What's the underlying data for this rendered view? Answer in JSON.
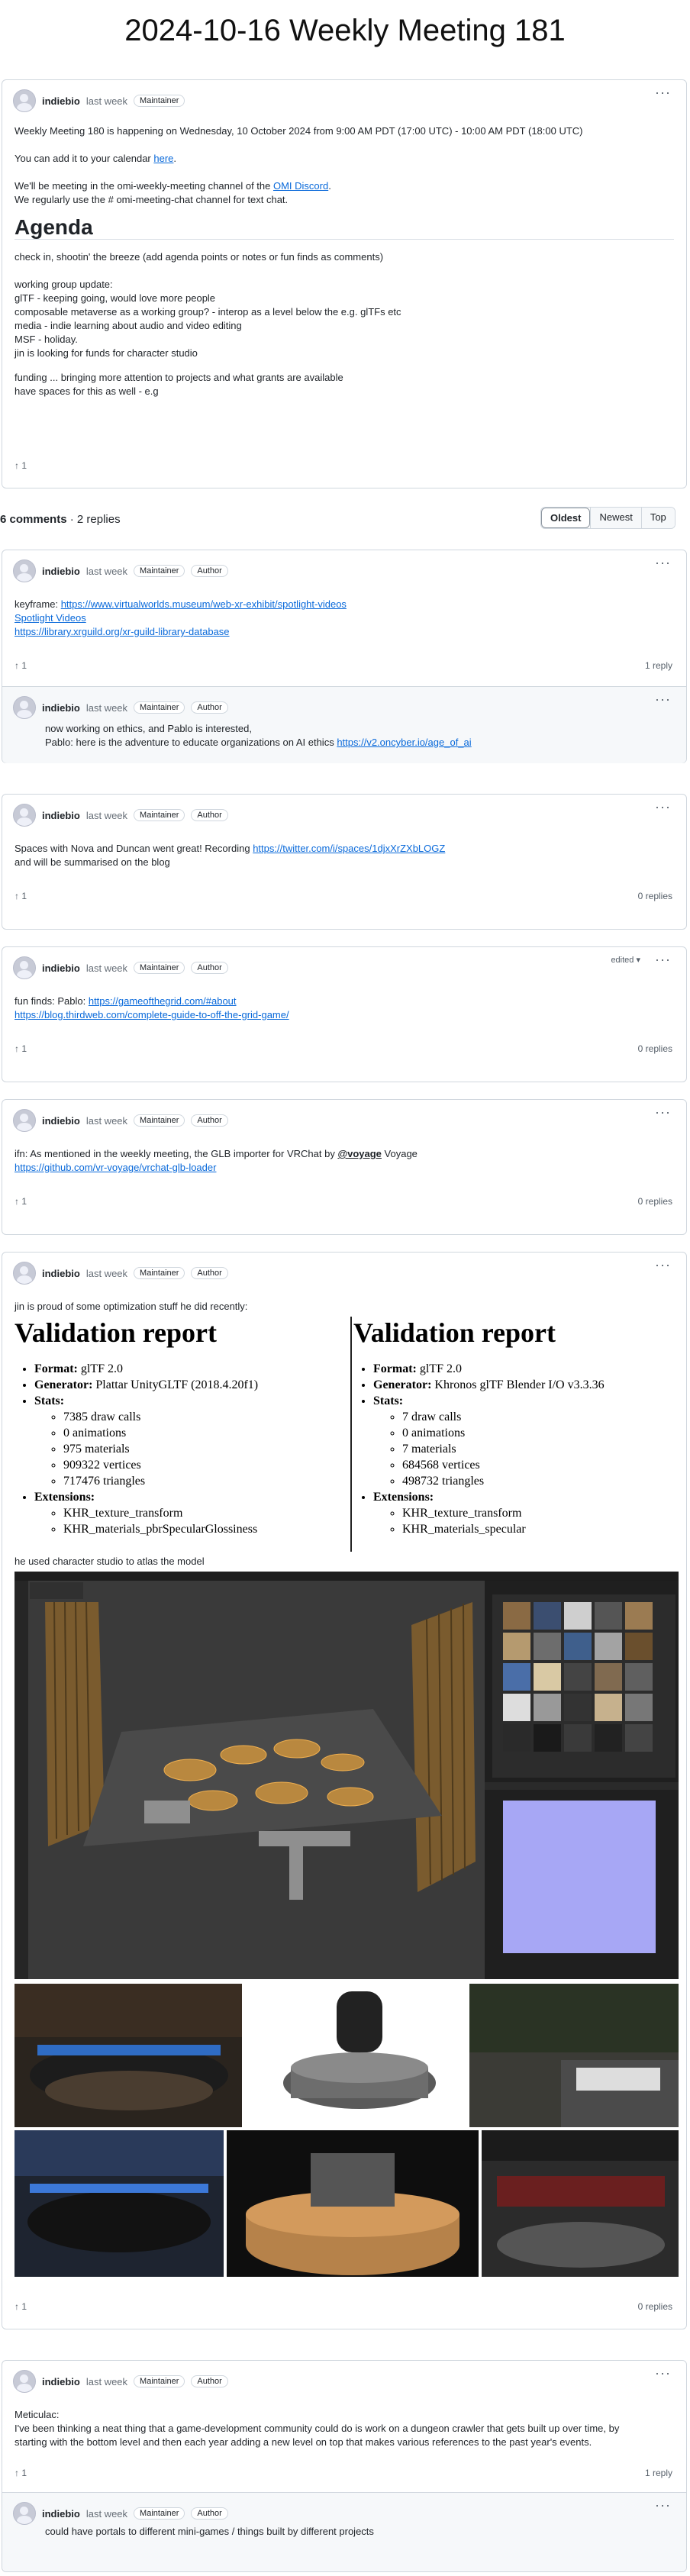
{
  "page_title": "2024-10-16 Weekly Meeting 181",
  "author": "indiebio",
  "time_ago": "last week",
  "badges": {
    "maintainer": "Maintainer",
    "author": "Author"
  },
  "more_label": "···",
  "edited_label": "edited ▾",
  "post": {
    "line1": "Weekly Meeting 180 is happening on Wednesday, 10 October 2024 from 9:00 AM PDT (17:00 UTC) - 10:00 AM PDT (18:00 UTC)",
    "calendar_prefix": "You can add it to your calendar ",
    "calendar_link": "here",
    "discord_prefix": "We'll be meeting in the omi-weekly-meeting channel of the ",
    "discord_link": "OMI Discord",
    "discord_line2": "We regularly use the # omi-meeting-chat channel for text chat.",
    "agenda_heading": "Agenda",
    "agenda_intro": "check in, shootin' the breeze (add agenda points or notes or fun finds as comments)",
    "wg_lines": [
      "working group update:",
      "glTF - keeping going, would love more people",
      "composable metaverse as a working group? - interop as a level below the e.g. glTFs etc",
      "media - indie learning about audio and video editing",
      "MSF - holiday.",
      "jin is looking for funds for character studio"
    ],
    "funding_lines": [
      "funding ... bringing more attention to projects and what grants are available",
      "have spaces for this as well - e.g"
    ],
    "reactions": "↑ 1"
  },
  "comments_header": {
    "count": "6 comments",
    "dot": " · ",
    "replies": "2 replies"
  },
  "sort": [
    "Oldest",
    "Newest",
    "Top"
  ],
  "comments": {
    "c1": {
      "prefix": "keyframe: ",
      "link1": "https://www.virtualworlds.museum/web-xr-exhibit/spotlight-videos",
      "link2": "Spotlight Videos",
      "link3": "https://library.xrguild.org/xr-guild-library-database",
      "reactions": "↑ 1",
      "replies": "1 reply"
    },
    "c1r": {
      "line1": "now working on ethics, and Pablo is interested,",
      "line2_prefix": "Pablo: here is the adventure to educate organizations on AI ethics ",
      "line2_link": "https://v2.oncyber.io/age_of_ai"
    },
    "c2": {
      "prefix": "Spaces with Nova and Duncan went great! Recording ",
      "link": "https://twitter.com/i/spaces/1djxXrZXbLOGZ",
      "line2": "and will be summarised on the blog",
      "reactions": "↑ 1",
      "replies": "0 replies"
    },
    "c3": {
      "prefix": "fun finds: Pablo: ",
      "link1": "https://gameofthegrid.com/#about",
      "link2": "https://blog.thirdweb.com/complete-guide-to-off-the-grid-game/",
      "reactions": "↑ 1",
      "replies": "0 replies"
    },
    "c4": {
      "prefix": "ifn: As mentioned in the weekly meeting, the GLB importer for VRChat by ",
      "mention": "@voyage",
      "suffix": " Voyage",
      "link": "https://github.com/vr-voyage/vrchat-glb-loader",
      "reactions": "↑ 1",
      "replies": "0 replies"
    },
    "c5": {
      "intro": "jin is proud of some optimization stuff he did recently:",
      "left": {
        "heading": "Validation report",
        "format_label": "Format:",
        "format": " glTF 2.0",
        "gen_label": "Generator:",
        "generator": " Plattar UnityGLTF (2018.4.20f1)",
        "stats_label": "Stats:",
        "stats": [
          "7385 draw calls",
          "0 animations",
          "975 materials",
          "909322 vertices",
          "717476 triangles"
        ],
        "ext_label": "Extensions:",
        "extensions": [
          "KHR_texture_transform",
          "KHR_materials_pbrSpecularGlossiness"
        ]
      },
      "right": {
        "heading": "Validation report",
        "format_label": "Format:",
        "format": " glTF 2.0",
        "gen_label": "Generator:",
        "generator": " Khronos glTF Blender I/O v3.3.36",
        "stats_label": "Stats:",
        "stats": [
          "7 draw calls",
          "0 animations",
          "7 materials",
          "684568 vertices",
          "498732 triangles"
        ],
        "ext_label": "Extensions:",
        "extensions": [
          "KHR_texture_transform",
          "KHR_materials_specular"
        ]
      },
      "atlas_line": "he used character studio to atlas the model",
      "reactions": "↑ 1",
      "replies": "0 replies"
    },
    "c6": {
      "line1": "Meticulac:",
      "line2": "I've been thinking a neat thing that a game-development community could do is work on a dungeon crawler that gets built up over time, by",
      "line3": "starting with the bottom level and then each year adding a new level on top that makes various references to the past year's events.",
      "reactions": "↑ 1",
      "replies": "1 reply"
    },
    "c6r": {
      "line1": "could have portals to different mini-games / things built by different projects"
    }
  },
  "colors": {
    "link": "#0969da",
    "border": "#d0d7de",
    "muted": "#656d76"
  }
}
